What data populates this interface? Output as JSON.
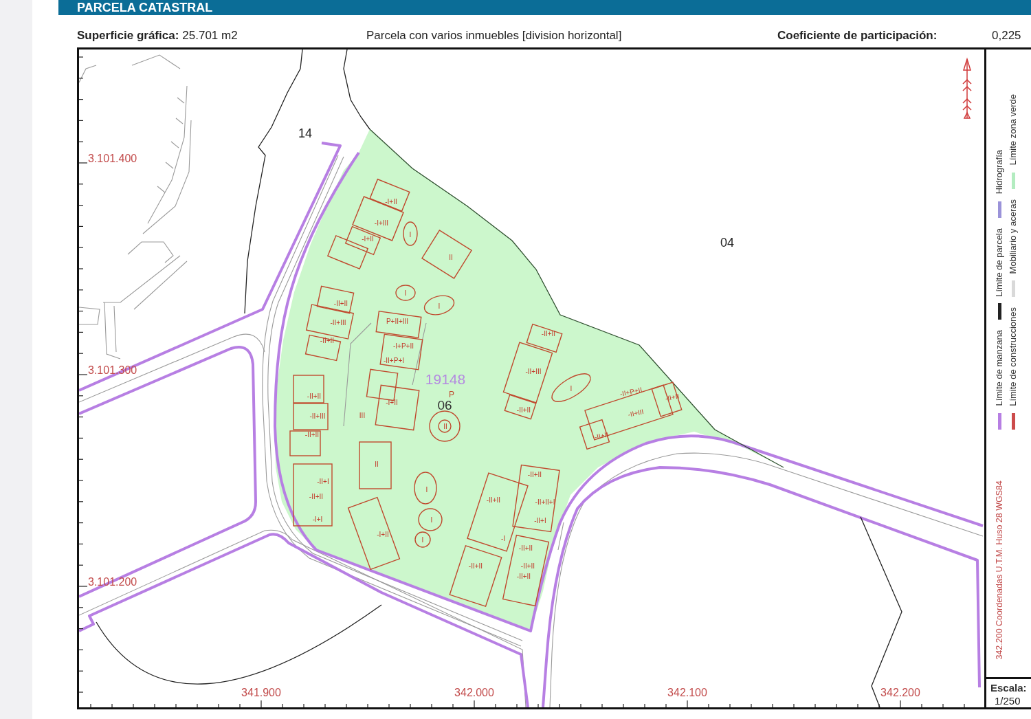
{
  "header": {
    "title": "PARCELA CATASTRAL"
  },
  "summary": {
    "area_label": "Superficie gráfica:",
    "area_value": "25.701 m2",
    "parcel_type": "Parcela con varios inmuebles [division horizontal]",
    "share_label": "Coeficiente de participación:",
    "share_value": "0,225"
  },
  "map": {
    "y_coordinates": [
      "3.101.400",
      "3.101.300",
      "3.101.200"
    ],
    "x_coordinates": [
      "341.900",
      "342.000",
      "342.100",
      "342.200"
    ],
    "parcel_labels": [
      "14",
      "04"
    ],
    "parcel_number": "19148",
    "subparcel": {
      "code": "P",
      "label": "06"
    },
    "building_labels": [
      "-I+II",
      "-I+III",
      "-I+II",
      "I",
      "II",
      "I",
      "I",
      "-II+II",
      "-II+III",
      "-II+II",
      "P+II+III",
      "-I+P+II",
      "-II+P+I",
      "-I+II",
      "III",
      "-II+II",
      "-II+III",
      "-II+II",
      "II",
      "-II+II",
      "-II+III",
      "-II+II",
      "I",
      "-II+P+II",
      "-II+III",
      "-II+II",
      "-II+II",
      "-II+I",
      "-II+II",
      "-I+I",
      "II",
      "-I+II",
      "I",
      "I",
      "I",
      "-II+II",
      "-II+II",
      "-II+II+I",
      "-II+I",
      "-I",
      "-II+II",
      "-II+II",
      "-II+II",
      "-II+II"
    ]
  },
  "legend": {
    "columns": [
      [
        {
          "label": "Límite de manzana",
          "color": "#b77fe3"
        },
        {
          "label": "Límite de parcela",
          "color": "#222222"
        },
        {
          "label": "Hidrografía",
          "color": "#9b93d9"
        }
      ],
      [
        {
          "label": "Límite de construcciones",
          "color": "#cc4b4b"
        },
        {
          "label": "Mobiliario y aceras",
          "color": "#d9d9d9"
        },
        {
          "label": "Límite zona verde",
          "color": "#b3ecc0"
        }
      ]
    ],
    "coordinate_note": "342.200 Coordenadas U.T.M. Huso 28 WGS84"
  },
  "scale": {
    "label": "Escala:",
    "value": "1/250"
  }
}
